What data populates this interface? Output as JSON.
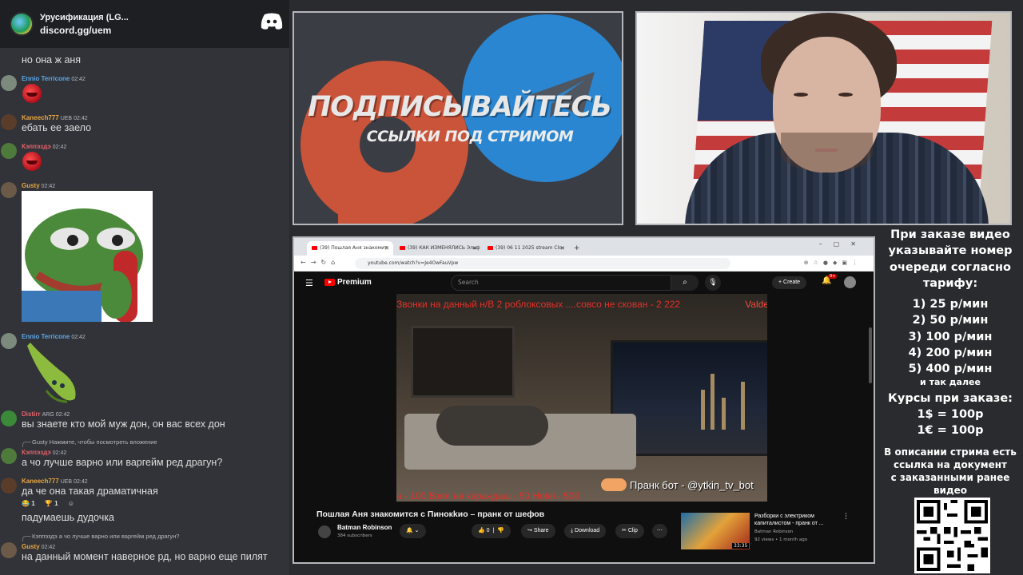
{
  "chat": {
    "invite": {
      "server_name": "Урусификация (LG...",
      "link": "discord.gg/uem"
    },
    "messages": [
      {
        "user": "",
        "text": "но она ж аня"
      },
      {
        "user": "Ennio Terricone",
        "time": "02:42"
      },
      {
        "user": "Kaneech777",
        "tag": "UEB",
        "time": "02:42",
        "text": "ебать ее заело"
      },
      {
        "user": "Кэппэздэ",
        "time": "02:42"
      },
      {
        "user": "Gusty",
        "time": "02:42"
      },
      {
        "user": "Ennio Terricone",
        "time": "02:42"
      },
      {
        "user": "Distirr",
        "tag": "ARG",
        "time": "02:42",
        "text": "вы знаете кто мой муж дон, он вас всех дон"
      },
      {
        "reply": "Gusty Нажмите, чтобы посмотреть вложение",
        "user": "Кэппэздэ",
        "time": "02:42",
        "text": "а чо лучше варно или варгейм ред драгун?"
      },
      {
        "user": "Kaneech777",
        "tag": "UEB",
        "time": "02:42",
        "text": "да че она такая драматичная",
        "reactions": [
          "1",
          "1"
        ]
      },
      {
        "text": "падумаешь дудочка"
      },
      {
        "reply": "Кэппэздэ а чо лучше варно или варгейм ред драгун?",
        "user": "Gusty",
        "time": "02:42",
        "text": "на данный момент наверное рд, но варно еще пилят"
      }
    ]
  },
  "promo": {
    "headline": "ПОДПИСЫВАЙТЕСЬ",
    "subheadline": "ССЫЛКИ ПОД СТРИМОМ"
  },
  "browser": {
    "tabs": [
      "(39) Пошлая Аня знакомит",
      "(39) КАК ИЗМЕНЯЛИСЬ Эльф",
      "(39) 06 11 2025 stream Clo"
    ],
    "url": "youtube.com/watch?v=Je4OwFauVpw",
    "youtube": {
      "brand": "Premium",
      "search_placeholder": "Search",
      "create_label": "Create",
      "notif_count": "9+",
      "video_overlay": {
        "ticker_top": "Звонки на данный н/В 2 роблоксовых ....совсо не скован - 2 222",
        "ticker_right": "Valder",
        "ticker_bottom": "н - 100          Взял на карандаш - 50          Hotel - 500",
        "prank": "Пранк бот - @ytkin_tv_bot"
      },
      "title": "Пошлая Аня знакомится с Пинокkио – пранк от шефов",
      "channel": "Batman Robinson",
      "subscribers": "384 subscribers",
      "likes": "0",
      "share": "Share",
      "download": "Download",
      "clip": "Clip",
      "rec": {
        "title": "Разборки с электриком капиталистом - пранк от ...",
        "channel": "Batman Robinson",
        "meta": "92 views • 1 month ago",
        "duration": "33:35"
      }
    }
  },
  "info": {
    "lines1": [
      "При заказе видео",
      "указывайте номер",
      "очереди согласно",
      "тарифу:"
    ],
    "rates": [
      "1) 25 р/мин",
      "2) 50 р/мин",
      "3) 100 р/мин",
      "4) 200 р/мин",
      "5) 400 р/мин"
    ],
    "etc": "и так далее",
    "courses_title": "Курсы при заказе:",
    "courses": [
      "1$ = 100р",
      "1€ = 100р"
    ],
    "desc": [
      "В описании стрима есть",
      "ссылка на документ",
      "с заказанными ранее",
      "видео"
    ]
  }
}
